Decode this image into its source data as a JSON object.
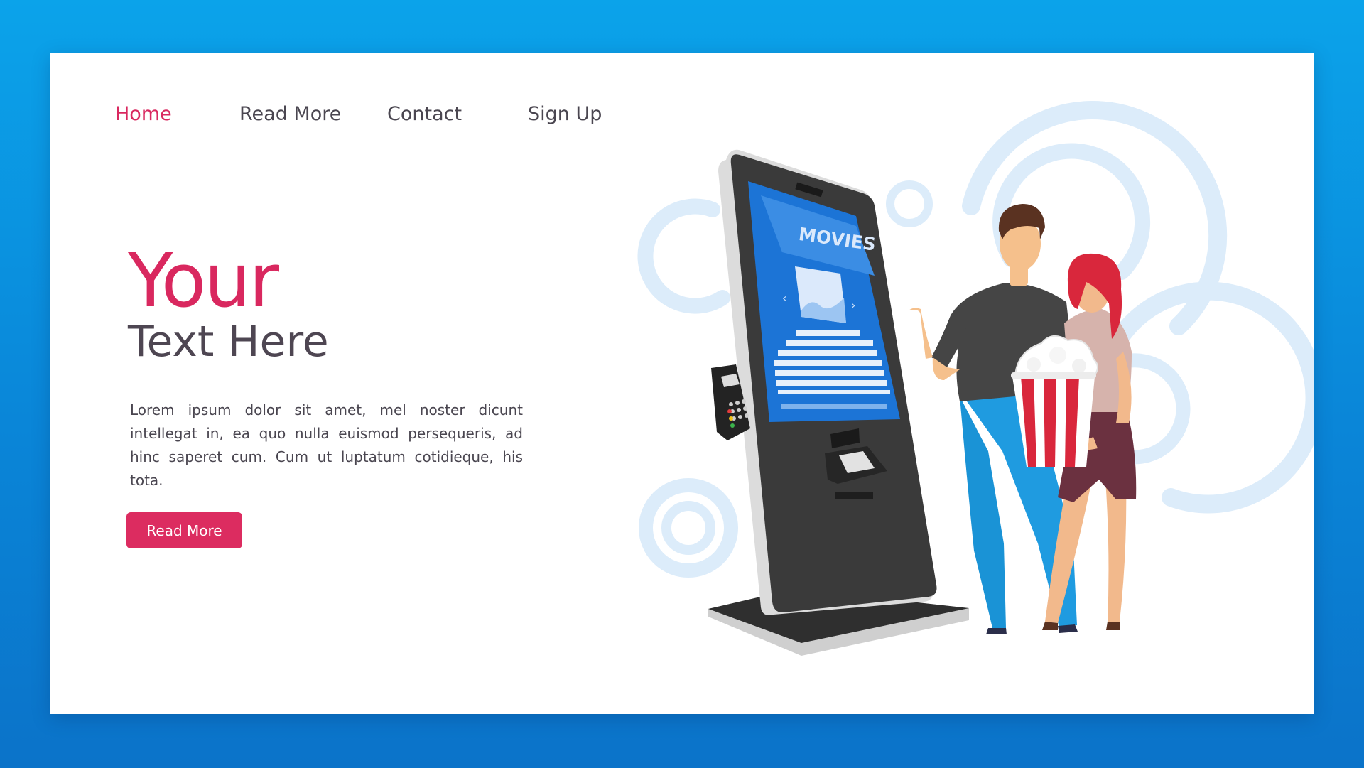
{
  "nav": {
    "items": [
      {
        "label": "Home",
        "active": true
      },
      {
        "label": "Read More",
        "active": false
      },
      {
        "label": "Contact",
        "active": false
      },
      {
        "label": "Sign Up",
        "active": false
      }
    ]
  },
  "hero": {
    "title": "Your",
    "subtitle": "Text Here",
    "body": "Lorem ipsum dolor sit amet, mel noster dicunt intellegat in, ea quo nulla euismod persequeris, ad hinc saperet cum. Cum ut luptatum cotidieque, his tota.",
    "cta_label": "Read More"
  },
  "illustration": {
    "screen_title": "MOVIES"
  },
  "colors": {
    "accent": "#dc2c60",
    "text": "#4a4650",
    "background_blue": "#0a8ddc",
    "decor_circles": "#dcecfa"
  }
}
